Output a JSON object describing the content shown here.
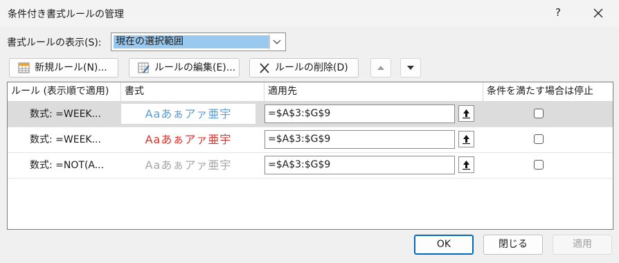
{
  "window": {
    "title": "条件付き書式ルールの管理",
    "help_glyph": "?"
  },
  "show_rules": {
    "label": "書式ルールの表示(S):",
    "selected": "現在の選択範囲"
  },
  "toolbar": {
    "new_rule": "新規ルール(N)...",
    "edit_rule": "ルールの編集(E)...",
    "delete_rule": "ルールの削除(D)"
  },
  "table": {
    "headers": [
      "ルール (表示順で適用)",
      "書式",
      "適用先",
      "条件を満たす場合は停止"
    ],
    "rows": [
      {
        "rule": "数式: =WEEK...",
        "preview": "Aaあぁアァ亜宇",
        "preview_color": "#5b9bd5",
        "applies_to": "=$A$3:$G$9",
        "stop": false,
        "selected": true
      },
      {
        "rule": "数式: =WEEK...",
        "preview": "Aaあぁアァ亜宇",
        "preview_color": "#e0302a",
        "applies_to": "=$A$3:$G$9",
        "stop": false,
        "selected": false
      },
      {
        "rule": "数式: =NOT(A...",
        "preview": "Aaあぁアァ亜宇",
        "preview_color": "#a6a6a6",
        "applies_to": "=$A$3:$G$9",
        "stop": false,
        "selected": false
      }
    ]
  },
  "buttons": {
    "ok": "OK",
    "close": "閉じる",
    "apply": "適用"
  },
  "colors": {
    "selection": "#99c9ef",
    "accent": "#0067c0"
  }
}
